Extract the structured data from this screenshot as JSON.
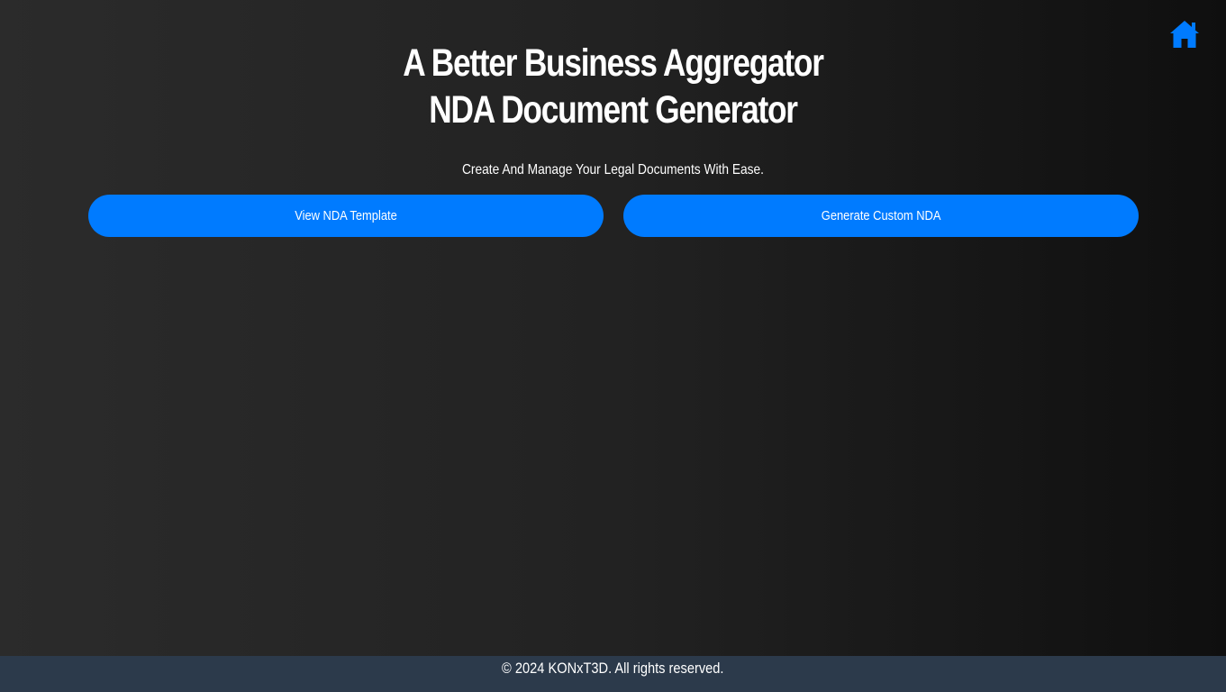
{
  "nav": {
    "home_icon": "home-icon",
    "accent_color": "#007bff"
  },
  "header": {
    "title_line1": "A Better Business Aggregator",
    "title_line2": "NDA Document Generator",
    "subtitle": "Create And Manage Your Legal Documents With Ease."
  },
  "actions": {
    "view_label": "View NDA Template",
    "generate_label": "Generate Custom NDA"
  },
  "footer": {
    "text": "© 2024 KONxT3D. All rights reserved.",
    "background": "#2c3a4b"
  }
}
